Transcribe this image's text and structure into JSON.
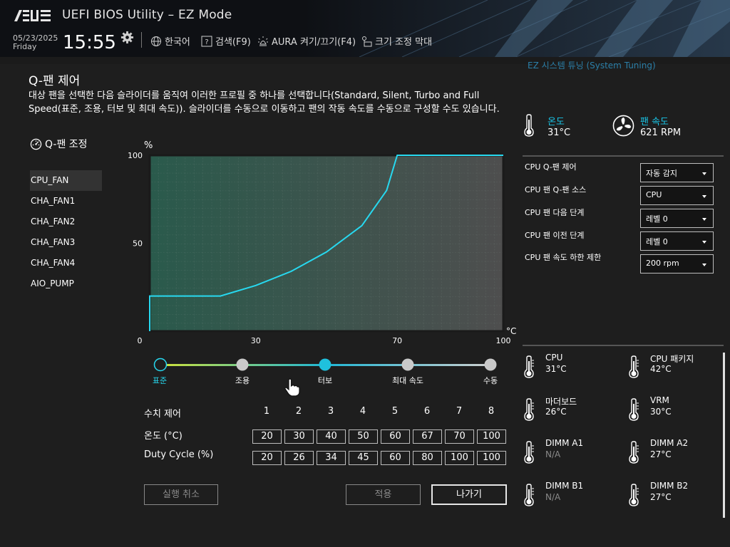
{
  "header": {
    "brand": "ASUS",
    "title": "UEFI BIOS Utility – EZ Mode",
    "date": "05/23/2025",
    "day": "Friday",
    "time": "15:55",
    "language": "한국어",
    "search": "검색(F9)",
    "aura": "AURA 켜기/끄기(F4)",
    "resize": "크기 조정 막대"
  },
  "qfan": {
    "title": "Q-팬 제어",
    "description": "대상 팬을 선택한 다음 슬라이더를 움직여 이러한 프로필 중 하나를 선택합니다(Standard, Silent, Turbo and Full Speed(표준, 조용, 터보 및 최대 속도)). 슬라이더를 수동으로 이동하고 팬의 작동 속도를 수동으로 구성할 수도 있습니다.",
    "section_title": "Q-팬 조정",
    "fans": [
      "CPU_FAN",
      "CHA_FAN1",
      "CHA_FAN2",
      "CHA_FAN3",
      "CHA_FAN4",
      "AIO_PUMP"
    ],
    "selected_fan": "CPU_FAN",
    "profiles": [
      "표준",
      "조용",
      "터보",
      "최대 속도",
      "수동"
    ],
    "selected_profile": "표준",
    "table": {
      "header_label": "수치 제어",
      "points": [
        "1",
        "2",
        "3",
        "4",
        "5",
        "6",
        "7",
        "8"
      ],
      "temp_label": "온도 (°C)",
      "temps": [
        "20",
        "30",
        "40",
        "50",
        "60",
        "67",
        "70",
        "100"
      ],
      "duty_label": "Duty Cycle (%)",
      "duties": [
        "20",
        "26",
        "34",
        "45",
        "60",
        "80",
        "100",
        "100"
      ]
    },
    "buttons": {
      "undo": "실행 취소",
      "apply": "적용",
      "exit": "나가기"
    }
  },
  "chart_data": {
    "type": "line",
    "ylabel": "%",
    "xlabel": "°C",
    "xlim": [
      0,
      100
    ],
    "ylim": [
      0,
      100
    ],
    "x_ticks": [
      "0",
      "30",
      "70",
      "100"
    ],
    "y_ticks": [
      "100",
      "50"
    ],
    "series": [
      {
        "x": [
          0,
          0,
          20,
          30,
          40,
          50,
          60,
          67,
          70,
          100
        ],
        "y": [
          0,
          20,
          20,
          26,
          34,
          45,
          60,
          80,
          100,
          100
        ]
      }
    ],
    "colors": {
      "line": "#27d9f0",
      "fill_left": "#2a5a4c",
      "fill_right": "#4e4e4e"
    }
  },
  "right": {
    "system_info_peek": "EZ 시스템 튜닝 (System Tuning)",
    "temp_label": "온도",
    "temp_value": "31°C",
    "fan_label": "팬 속도",
    "fan_value": "621 RPM",
    "settings": [
      {
        "label": "CPU Q-팬 제어",
        "value": "자동 감지"
      },
      {
        "label": "CPU 팬 Q-팬 소스",
        "value": "CPU"
      },
      {
        "label": "CPU 팬 다음 단계",
        "value": "레벨 0"
      },
      {
        "label": "CPU 팬 이전 단계",
        "value": "레벨 0"
      },
      {
        "label": "CPU 팬 속도 하한 제한",
        "value": "200 rpm"
      }
    ],
    "sensors": [
      {
        "name": "CPU",
        "value": "31°C"
      },
      {
        "name": "CPU 패키지",
        "value": "42°C"
      },
      {
        "name": "마더보드",
        "value": "26°C"
      },
      {
        "name": "VRM",
        "value": "30°C"
      },
      {
        "name": "DIMM A1",
        "value": "N/A"
      },
      {
        "name": "DIMM A2",
        "value": "27°C"
      },
      {
        "name": "DIMM B1",
        "value": "N/A"
      },
      {
        "name": "DIMM B2",
        "value": "27°C"
      }
    ]
  }
}
